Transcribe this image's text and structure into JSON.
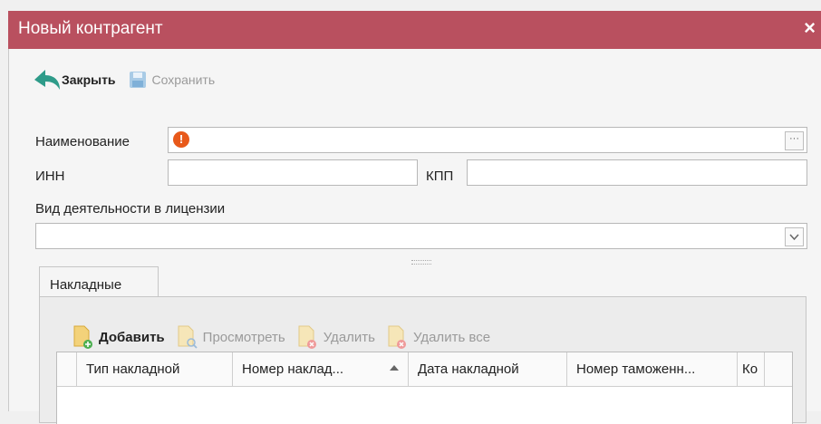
{
  "window": {
    "title": "Новый контрагент",
    "close_glyph": "×"
  },
  "toolbar": {
    "close_label": "Закрыть",
    "save_label": "Сохранить"
  },
  "form": {
    "name_label": "Наименование",
    "name_value": "",
    "name_error_glyph": "!",
    "name_browse_glyph": "···",
    "inn_label": "ИНН",
    "inn_value": "",
    "kpp_label": "КПП",
    "kpp_value": "",
    "activity_label": "Вид деятельности в лицензии",
    "activity_value": ""
  },
  "tabs": [
    {
      "label": "Накладные"
    }
  ],
  "panel_toolbar": {
    "add_label": "Добавить",
    "view_label": "Просмотреть",
    "delete_label": "Удалить",
    "delete_all_label": "Удалить все"
  },
  "grid": {
    "columns": [
      "Тип накладной",
      "Номер наклад...",
      "Дата накладной",
      "Номер таможенн...",
      "Ко"
    ]
  },
  "colors": {
    "titlebar": "#b9505f",
    "accent_icon": "#2e9b89",
    "error": "#e8591a",
    "add_badge": "#4caf50",
    "delete_badge": "#e76b6b"
  }
}
